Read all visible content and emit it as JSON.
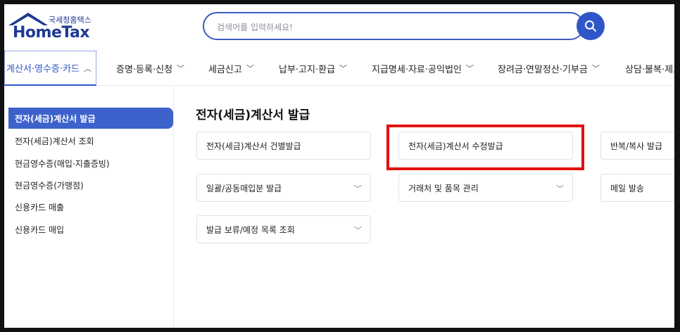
{
  "header": {
    "logo_sub": "국세청홈택스",
    "logo_brand": "HomeTax",
    "search_placeholder": "검색어를 입력하세요!"
  },
  "menu": [
    {
      "label": "계산서·영수증·카드",
      "active": true
    },
    {
      "label": "증명·등록·신청"
    },
    {
      "label": "세금신고"
    },
    {
      "label": "납부·고지·환급"
    },
    {
      "label": "지급명세·자료·공익법인"
    },
    {
      "label": "장려금·연말정산·기부금"
    },
    {
      "label": "상담·불복·제보"
    }
  ],
  "sidebar": {
    "items": [
      {
        "label": "전자(세금)계산서 발급",
        "active": true
      },
      {
        "label": "전자(세금)계산서 조회"
      },
      {
        "label": "현금영수증(매입·지출증빙)"
      },
      {
        "label": "현금영수증(가맹점)"
      },
      {
        "label": "신용카드 매출"
      },
      {
        "label": "신용카드 매입"
      }
    ]
  },
  "content": {
    "title": "전자(세금)계산서 발급",
    "cards": [
      {
        "label": "전자(세금)계산서 건별발급"
      },
      {
        "label": "전자(세금)계산서 수정발급"
      },
      {
        "label": "반복/복사 발급"
      },
      {
        "label": "일괄/공동매입분 발급"
      },
      {
        "label": "거래처 및 품목 관리"
      },
      {
        "label": "메일 발송"
      },
      {
        "label": "발급 보류/예정 목록 조회"
      }
    ]
  },
  "colors": {
    "accent": "#2e56c8",
    "highlight": "#e31010"
  }
}
